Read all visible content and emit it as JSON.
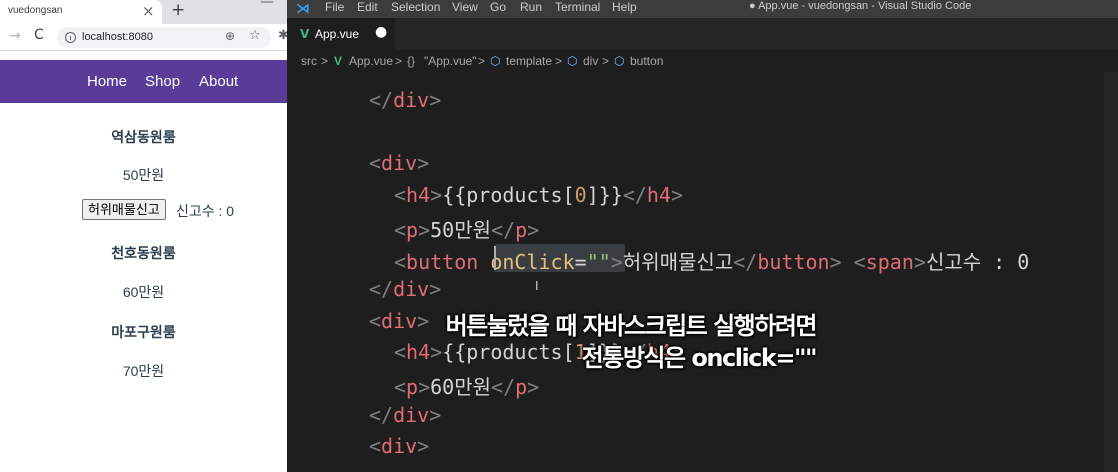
{
  "browser": {
    "tab_title": "vuedongsan",
    "tab_close": "×",
    "new_tab": "+",
    "window_minimize": "—",
    "nav_back": "→",
    "nav_reload": "C",
    "url": "localhost:8080",
    "zoom_glyph": "⊕",
    "star_glyph": "☆",
    "ext_glyph": "✱"
  },
  "site": {
    "nav": [
      "Home",
      "Shop",
      "About"
    ],
    "nav_color": "#5a3c98",
    "products": [
      {
        "title": "역삼동원룸",
        "price": "50만원"
      },
      {
        "title": "천호동원룸",
        "price": "60만원"
      },
      {
        "title": "마포구원룸",
        "price": "70만원"
      }
    ],
    "report_button": "허위매물신고",
    "report_count": "신고수 : 0"
  },
  "vscode": {
    "logo": "⋊",
    "menu": [
      "File",
      "Edit",
      "Selection",
      "View",
      "Go",
      "Run",
      "Terminal",
      "Help"
    ],
    "window_title": "● App.vue - vuedongsan - Visual Studio Code",
    "tab": {
      "icon": "V",
      "filename": "App.vue",
      "dirty_dot": "●"
    },
    "breadcrumb": {
      "src": "src",
      "sep": ">",
      "vue_icon": "V",
      "file": "App.vue",
      "braces": "{}",
      "component": "\"App.vue\"",
      "cube": "⬡",
      "template": "template",
      "div": "div",
      "button": "button"
    },
    "code": {
      "l1_close": "div",
      "l3_open": "div",
      "h4": "h4",
      "p": "p",
      "button": "button",
      "span": "span",
      "products_expr_0": "{{products[",
      "idx0": "0",
      "expr_close": "]}}",
      "price_0": "50만원",
      "attr": "onClick",
      "eq": "=",
      "str": "\"\"",
      "button_text": "허위매물신고",
      "span_text": "신고수 : 0",
      "idx1": "1",
      "price_1": "60만원",
      "lt": "<",
      "lts": "</",
      "gt": ">"
    },
    "ibeam": "I",
    "accent": "#3b9ff1"
  },
  "caption": {
    "line1": "버튼눌렀을 때 자바스크립트 실행하려면",
    "line2": "전통방식은 onclick=\"\""
  }
}
